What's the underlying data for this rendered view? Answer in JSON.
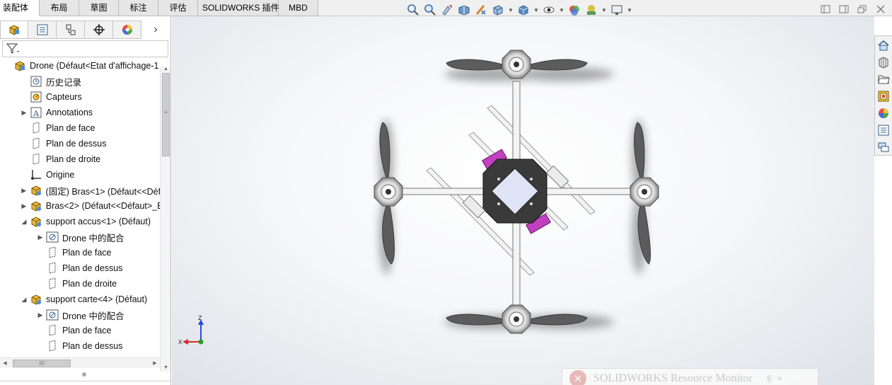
{
  "tabs": [
    {
      "label": "装配体",
      "active": true
    },
    {
      "label": "布局",
      "active": false
    },
    {
      "label": "草图",
      "active": false
    },
    {
      "label": "标注",
      "active": false
    },
    {
      "label": "评估",
      "active": false
    },
    {
      "label": "SOLIDWORKS 插件",
      "active": false
    },
    {
      "label": "MBD",
      "active": false
    }
  ],
  "hud_toolbar": [
    "zoom-to-fit-icon",
    "zoom-to-area-icon",
    "previous-view-icon",
    "section-view-icon",
    "dynamic-annotation-icon",
    "view-orientation-icon",
    "display-style-icon",
    "hide-show-items-icon",
    "edit-appearance-icon",
    "apply-scene-icon",
    "view-settings-icon"
  ],
  "window_controls": [
    "tile-left-icon",
    "tile-right-icon",
    "restore-icon",
    "close-icon"
  ],
  "manager_tabs": [
    "featuremanager-icon",
    "propertymanager-icon",
    "configurationmanager-icon",
    "dimxpertmanager-icon",
    "displaymanager-icon"
  ],
  "manager_more": "›",
  "tree": [
    {
      "label": "Drone  (Défaut<Etat d'affichage-1",
      "icon": "assembly-icon",
      "indent": 0,
      "expander": ""
    },
    {
      "label": "历史记录",
      "icon": "history-icon",
      "indent": 1,
      "expander": ""
    },
    {
      "label": "Capteurs",
      "icon": "sensors-icon",
      "indent": 1,
      "expander": ""
    },
    {
      "label": "Annotations",
      "icon": "annotations-icon",
      "indent": 1,
      "expander": "▶"
    },
    {
      "label": "Plan de face",
      "icon": "plane-icon",
      "indent": 1,
      "expander": ""
    },
    {
      "label": "Plan de dessus",
      "icon": "plane-icon",
      "indent": 1,
      "expander": ""
    },
    {
      "label": "Plan de droite",
      "icon": "plane-icon",
      "indent": 1,
      "expander": ""
    },
    {
      "label": "Origine",
      "icon": "origin-icon",
      "indent": 1,
      "expander": ""
    },
    {
      "label": "(固定) Bras<1> (Défaut<<Défa",
      "icon": "part-icon",
      "indent": 1,
      "expander": "▶"
    },
    {
      "label": "Bras<2> (Défaut<<Défaut>_E",
      "icon": "part-icon",
      "indent": 1,
      "expander": "▶"
    },
    {
      "label": "support accus<1> (Défaut)",
      "icon": "part-icon",
      "indent": 1,
      "expander": "◢"
    },
    {
      "label": "Drone 中的配合",
      "icon": "mates-icon",
      "indent": 2,
      "expander": "▶"
    },
    {
      "label": "Plan de face",
      "icon": "plane-icon",
      "indent": 2,
      "expander": ""
    },
    {
      "label": "Plan de dessus",
      "icon": "plane-icon",
      "indent": 2,
      "expander": ""
    },
    {
      "label": "Plan de droite",
      "icon": "plane-icon",
      "indent": 2,
      "expander": ""
    },
    {
      "label": "support carte<4> (Défaut)",
      "icon": "part-icon",
      "indent": 1,
      "expander": "◢"
    },
    {
      "label": "Drone 中的配合",
      "icon": "mates-icon",
      "indent": 2,
      "expander": "▶"
    },
    {
      "label": "Plan de face",
      "icon": "plane-icon",
      "indent": 2,
      "expander": ""
    },
    {
      "label": "Plan de dessus",
      "icon": "plane-icon",
      "indent": 2,
      "expander": ""
    }
  ],
  "scrollbar": {
    "h_thumb_glyph": "III",
    "v_thumb_glyph": "≡"
  },
  "triad": {
    "z": "Z",
    "x": "X"
  },
  "resource_monitor": {
    "title": "SOLIDWORKS Resource Monitor",
    "icon_glyph": "✕",
    "pin": "§",
    "close": "×"
  },
  "task_pane": [
    "home-icon",
    "design-library-icon",
    "file-explorer-icon",
    "view-palette-icon",
    "appearances-icon",
    "custom-properties-icon",
    "forum-icon"
  ],
  "colors": {
    "accent": "#4a7ab8",
    "tab_bg": "#e6e6e6",
    "viewport_edge": "#dde1e7",
    "propeller": "#5a5a5a",
    "magenta": "#c040c0"
  }
}
